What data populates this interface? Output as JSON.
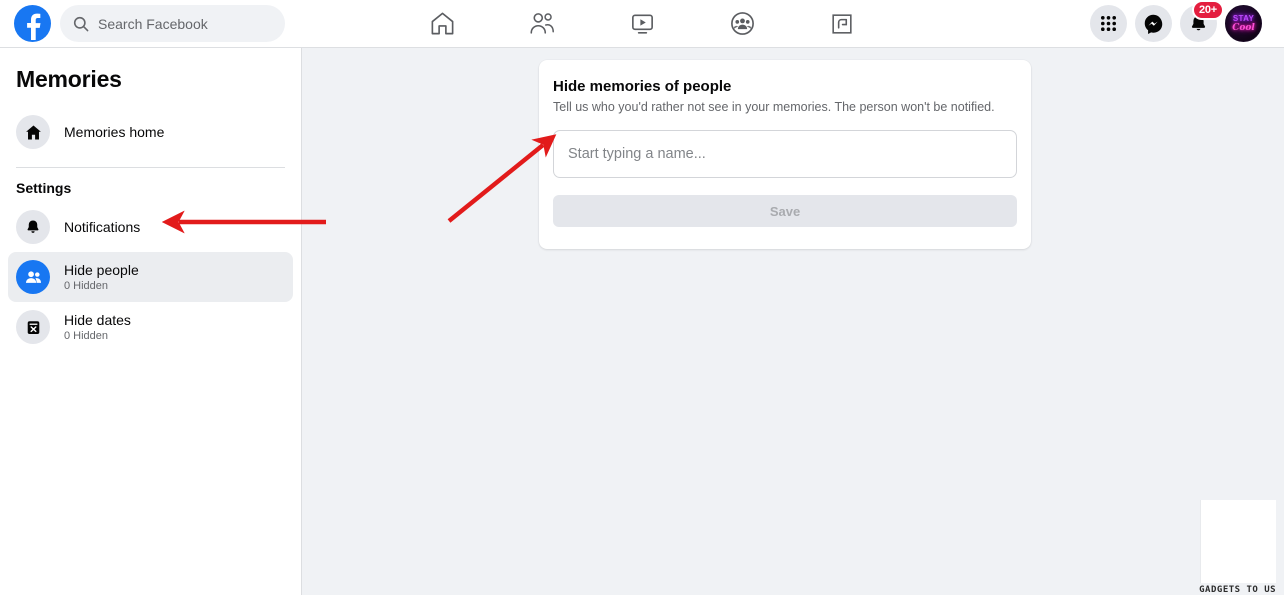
{
  "topbar": {
    "logo_icon": "facebook-logo-icon",
    "search": {
      "placeholder": "Search Facebook",
      "icon": "search-icon"
    },
    "nav": [
      {
        "id": "home",
        "icon": "home-icon",
        "label": "Home"
      },
      {
        "id": "friends",
        "icon": "friends-icon",
        "label": "Friends"
      },
      {
        "id": "video",
        "icon": "video-icon",
        "label": "Video"
      },
      {
        "id": "groups",
        "icon": "groups-icon",
        "label": "Groups"
      },
      {
        "id": "gaming",
        "icon": "gaming-icon",
        "label": "Gaming"
      }
    ],
    "actions": [
      {
        "id": "menu",
        "icon": "grid-menu-icon",
        "label": "Menu"
      },
      {
        "id": "messenger",
        "icon": "messenger-icon",
        "label": "Messenger"
      },
      {
        "id": "notifications",
        "icon": "bell-icon",
        "label": "Notifications",
        "badge": "20+"
      }
    ],
    "avatar": {
      "icon": "avatar",
      "line1": "STAY",
      "line2": "Cool"
    }
  },
  "sidebar": {
    "title": "Memories",
    "home_item": {
      "label": "Memories home",
      "icon": "home-filled-icon"
    },
    "settings_heading": "Settings",
    "items": [
      {
        "label": "Notifications",
        "sub": "",
        "icon": "bell-filled-icon",
        "active": false
      },
      {
        "label": "Hide people",
        "sub": "0 Hidden",
        "icon": "people-filled-icon",
        "active": true
      },
      {
        "label": "Hide dates",
        "sub": "0 Hidden",
        "icon": "calendar-x-icon",
        "active": false
      }
    ]
  },
  "card": {
    "title": "Hide memories of people",
    "subtitle": "Tell us who you'd rather not see in your memories. The person won't be notified.",
    "input_placeholder": "Start typing a name...",
    "input_value": "",
    "save_label": "Save"
  },
  "annotations": {
    "arrow_color": "#e21b1b",
    "arrow_to_input": "arrow-pointing-to-name-input",
    "arrow_to_hide_people": "arrow-pointing-to-hide-people"
  },
  "watermark": {
    "text": "GADGETS TO USE"
  },
  "colors": {
    "brand_blue": "#1877f2",
    "page_bg": "#f0f2f5",
    "card_bg": "#ffffff",
    "badge_red": "#e41e3f",
    "arrow_red": "#e21b1b"
  }
}
